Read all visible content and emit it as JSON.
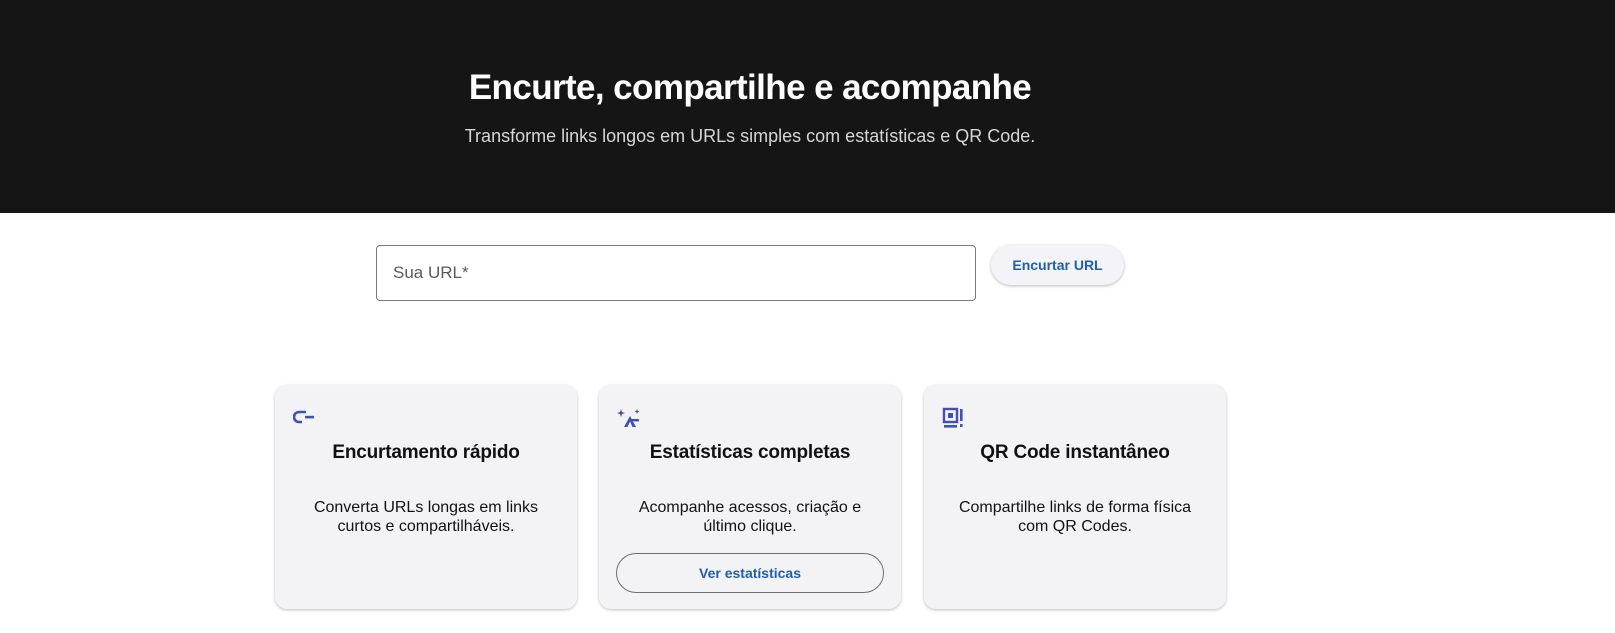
{
  "hero": {
    "title": "Encurte, compartilhe e acompanhe",
    "subtitle": "Transforme links longos em URLs simples com estatísticas e QR Code."
  },
  "shortener": {
    "url_placeholder": "Sua URL*",
    "url_value": "",
    "submit_label": "Encurtar URL"
  },
  "features": [
    {
      "icon": "link-icon",
      "title": "Encurtamento rápido",
      "description": "Converta URLs longas em links curtos e compartilháveis."
    },
    {
      "icon": "insights-icon",
      "title": "Estatísticas completas",
      "description": "Acompanhe acessos, criação e último clique.",
      "action_label": "Ver estatísticas"
    },
    {
      "icon": "qr-code-icon",
      "title": "QR Code instantâneo",
      "description": "Compartilhe links de forma física com QR Codes."
    }
  ],
  "colors": {
    "hero_background": "#151515",
    "accent": "#1f5fa8",
    "icon": "#3f51b5",
    "card_background": "#f3f3f6"
  }
}
